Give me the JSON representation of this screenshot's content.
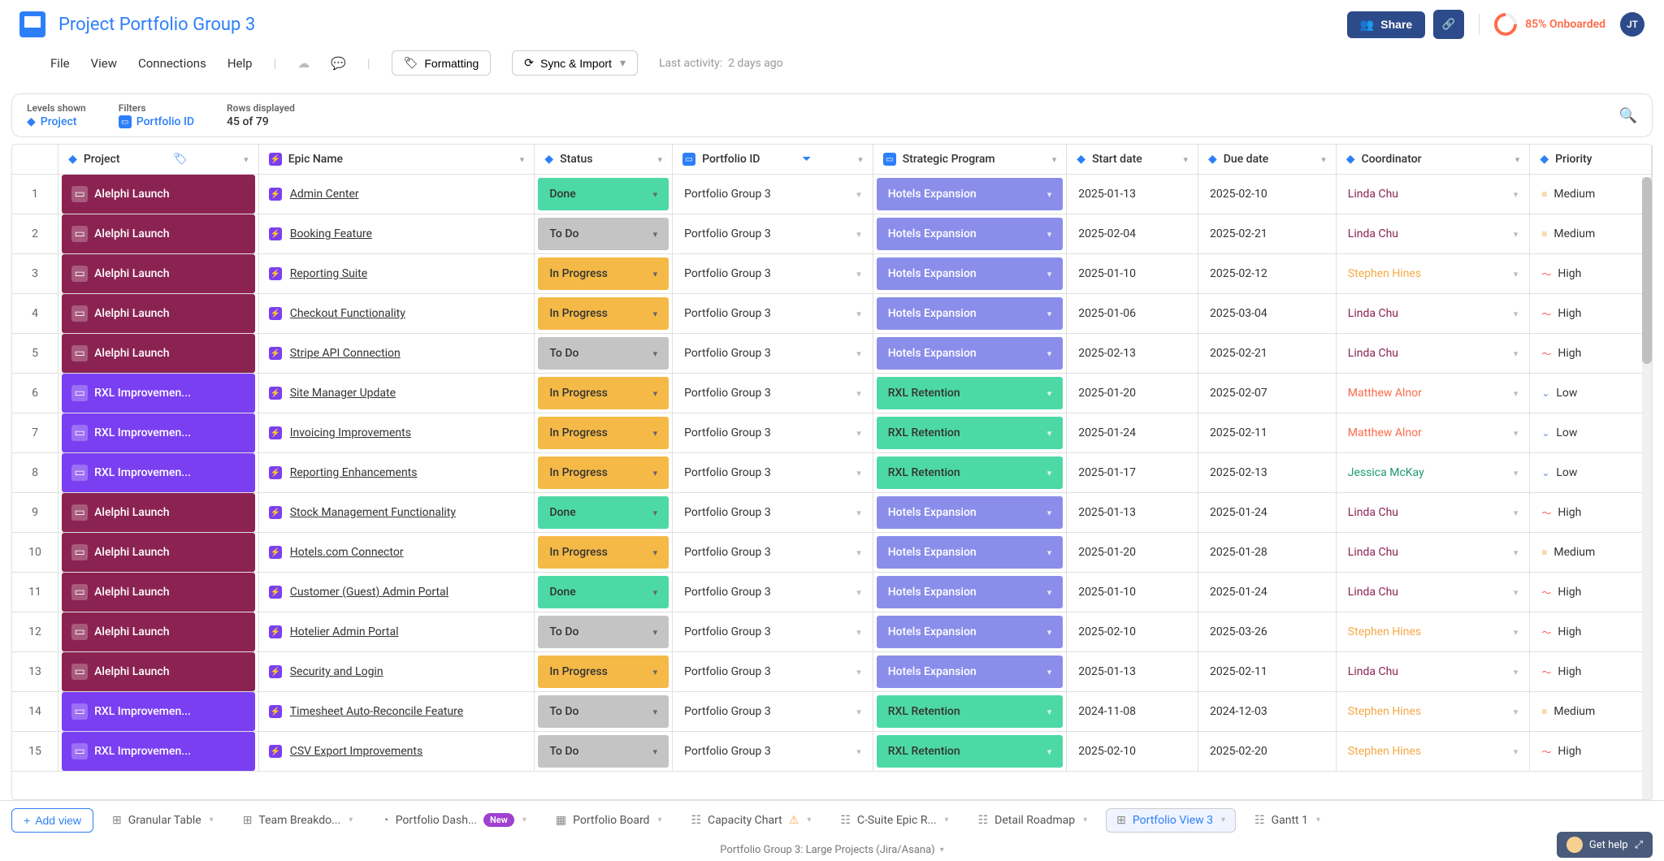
{
  "header": {
    "title": "Project Portfolio Group 3",
    "share": "Share",
    "onboard": "85% Onboarded",
    "avatar": "JT"
  },
  "menu": {
    "file": "File",
    "view": "View",
    "connections": "Connections",
    "help": "Help",
    "formatting": "Formatting",
    "sync": "Sync & Import",
    "activity_label": "Last activity:",
    "activity_value": "2 days ago"
  },
  "filters": {
    "levels_label": "Levels shown",
    "levels_value": "Project",
    "filters_label": "Filters",
    "filters_value": "Portfolio ID",
    "rows_label": "Rows displayed",
    "rows_value": "45 of 79"
  },
  "columns": {
    "project": "Project",
    "epic": "Epic Name",
    "status": "Status",
    "portfolio": "Portfolio ID",
    "program": "Strategic Program",
    "start": "Start date",
    "due": "Due date",
    "coord": "Coordinator",
    "priority": "Priority"
  },
  "statuses": {
    "done": "Done",
    "todo": "To Do",
    "progress": "In Progress"
  },
  "programs": {
    "hotels": "Hotels Expansion",
    "rxl": "RXL Retention"
  },
  "projects": {
    "alelphi": "Alelphi Launch",
    "rxl": "RXL Improvemen..."
  },
  "priorities": {
    "high": "High",
    "medium": "Medium",
    "low": "Low"
  },
  "portfolio_value": "Portfolio Group 3",
  "coordinators": {
    "linda": "Linda Chu",
    "stephen": "Stephen Hines",
    "matthew": "Matthew Alnor",
    "jessica": "Jessica McKay"
  },
  "rows": [
    {
      "n": 1,
      "proj": "alelphi",
      "epic": "Admin Center",
      "status": "done",
      "prog": "hotels",
      "start": "2025-01-13",
      "due": "2025-02-10",
      "coord": "linda",
      "pri": "medium"
    },
    {
      "n": 2,
      "proj": "alelphi",
      "epic": "Booking Feature",
      "status": "todo",
      "prog": "hotels",
      "start": "2025-02-04",
      "due": "2025-02-21",
      "coord": "linda",
      "pri": "medium"
    },
    {
      "n": 3,
      "proj": "alelphi",
      "epic": "Reporting Suite",
      "status": "progress",
      "prog": "hotels",
      "start": "2025-01-10",
      "due": "2025-02-12",
      "coord": "stephen",
      "pri": "high"
    },
    {
      "n": 4,
      "proj": "alelphi",
      "epic": "Checkout Functionality",
      "status": "progress",
      "prog": "hotels",
      "start": "2025-01-06",
      "due": "2025-03-04",
      "coord": "linda",
      "pri": "high"
    },
    {
      "n": 5,
      "proj": "alelphi",
      "epic": "Stripe API Connection",
      "status": "todo",
      "prog": "hotels",
      "start": "2025-02-13",
      "due": "2025-02-21",
      "coord": "linda",
      "pri": "high"
    },
    {
      "n": 6,
      "proj": "rxl",
      "epic": "Site Manager Update",
      "status": "progress",
      "prog": "rxl",
      "start": "2025-01-20",
      "due": "2025-02-07",
      "coord": "matthew",
      "pri": "low"
    },
    {
      "n": 7,
      "proj": "rxl",
      "epic": "Invoicing Improvements",
      "status": "progress",
      "prog": "rxl",
      "start": "2025-01-24",
      "due": "2025-02-11",
      "coord": "matthew",
      "pri": "low"
    },
    {
      "n": 8,
      "proj": "rxl",
      "epic": "Reporting Enhancements",
      "status": "progress",
      "prog": "rxl",
      "start": "2025-01-17",
      "due": "2025-02-13",
      "coord": "jessica",
      "pri": "low"
    },
    {
      "n": 9,
      "proj": "alelphi",
      "epic": "Stock Management Functionality",
      "status": "done",
      "prog": "hotels",
      "start": "2025-01-13",
      "due": "2025-01-24",
      "coord": "linda",
      "pri": "high"
    },
    {
      "n": 10,
      "proj": "alelphi",
      "epic": "Hotels.com Connector",
      "status": "progress",
      "prog": "hotels",
      "start": "2025-01-20",
      "due": "2025-01-28",
      "coord": "linda",
      "pri": "medium"
    },
    {
      "n": 11,
      "proj": "alelphi",
      "epic": "Customer (Guest) Admin Portal",
      "status": "done",
      "prog": "hotels",
      "start": "2025-01-10",
      "due": "2025-01-24",
      "coord": "linda",
      "pri": "high"
    },
    {
      "n": 12,
      "proj": "alelphi",
      "epic": "Hotelier Admin Portal",
      "status": "todo",
      "prog": "hotels",
      "start": "2025-02-10",
      "due": "2025-03-26",
      "coord": "stephen",
      "pri": "high"
    },
    {
      "n": 13,
      "proj": "alelphi",
      "epic": "Security and Login",
      "status": "progress",
      "prog": "hotels",
      "start": "2025-01-13",
      "due": "2025-02-11",
      "coord": "linda",
      "pri": "high"
    },
    {
      "n": 14,
      "proj": "rxl",
      "epic": "Timesheet Auto-Reconcile Feature",
      "status": "todo",
      "prog": "rxl",
      "start": "2024-11-08",
      "due": "2024-12-03",
      "coord": "stephen",
      "pri": "medium"
    },
    {
      "n": 15,
      "proj": "rxl",
      "epic": "CSV Export Improvements",
      "status": "todo",
      "prog": "rxl",
      "start": "2025-02-10",
      "due": "2025-02-20",
      "coord": "stephen",
      "pri": "high"
    }
  ],
  "tabs": {
    "add_view": "Add view",
    "granular": "Granular Table",
    "team": "Team Breakdo...",
    "dashboard": "Portfolio Dash...",
    "new_badge": "New",
    "board": "Portfolio Board",
    "capacity": "Capacity Chart",
    "csuite": "C-Suite Epic R...",
    "roadmap": "Detail Roadmap",
    "portfolio_view": "Portfolio View 3",
    "gantt": "Gantt 1"
  },
  "footer": {
    "text": "Portfolio Group 3: Large Projects (Jira/Asana)",
    "help": "Get help"
  }
}
